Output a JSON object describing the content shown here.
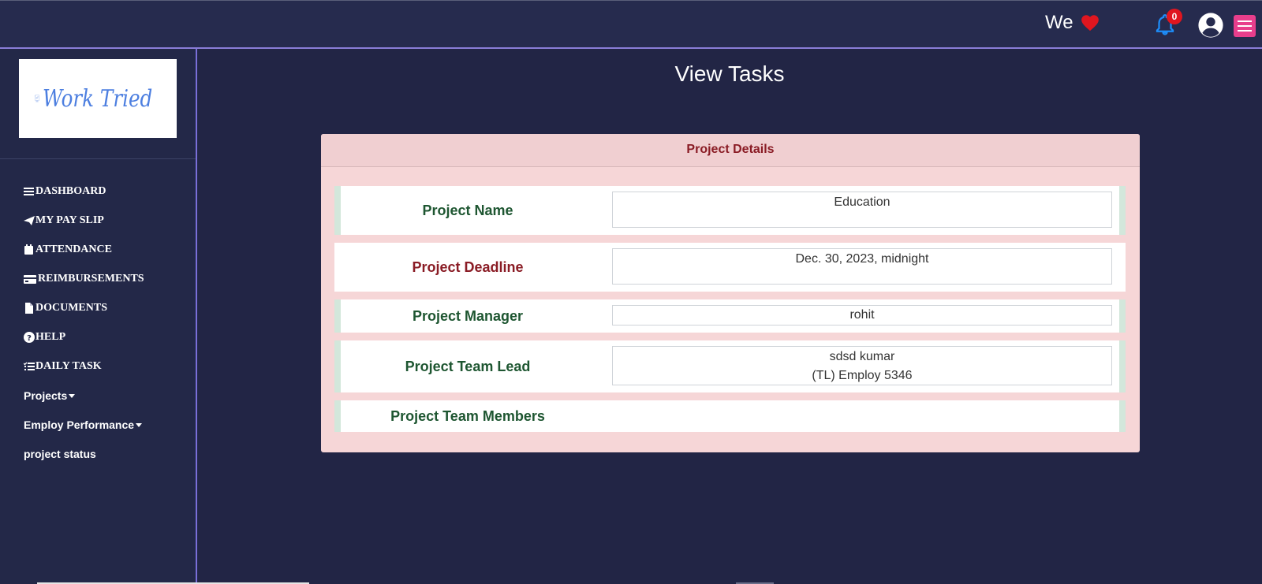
{
  "header": {
    "greeting": "We",
    "notification_count": "0",
    "icons": [
      "heart-icon",
      "bell-icon",
      "user-circle-icon",
      "hamburger-menu-icon"
    ],
    "colors": {
      "heart": "#e0161f",
      "bell": "#1d8cf8",
      "badge": "#e0161f",
      "menu_button": "#e83e8c"
    }
  },
  "sidebar": {
    "logo_text": "Work Tried",
    "items": [
      {
        "label": "DASHBOARD",
        "icon": "bars-icon"
      },
      {
        "label": "MY PAY SLIP",
        "icon": "paper-plane-icon"
      },
      {
        "label": "ATTENDANCE",
        "icon": "calendar-icon"
      },
      {
        "label": "REIMBURSEMENTS",
        "icon": "credit-card-icon"
      },
      {
        "label": "DOCUMENTS",
        "icon": "file-icon"
      },
      {
        "label": "HELP",
        "icon": "question-circle-icon"
      },
      {
        "label": "DAILY TASK",
        "icon": "task-list-icon"
      },
      {
        "label": "Projects",
        "icon": "caret-down-icon"
      },
      {
        "label": "Employ Performance",
        "icon": "caret-down-icon"
      },
      {
        "label": "project status"
      }
    ]
  },
  "main": {
    "title": "View Tasks",
    "card_title": "Project Details",
    "fields": [
      {
        "label": "Project Name",
        "value": "Education"
      },
      {
        "label": "Project Deadline",
        "value": "Dec. 30, 2023, midnight"
      },
      {
        "label": "Project Manager",
        "value": "rohit"
      },
      {
        "label": "Project Team Lead",
        "value_line1": "sdsd kumar",
        "value_line2": "(TL) Employ 5346"
      },
      {
        "label": "Project Team Members",
        "value": ""
      }
    ]
  }
}
